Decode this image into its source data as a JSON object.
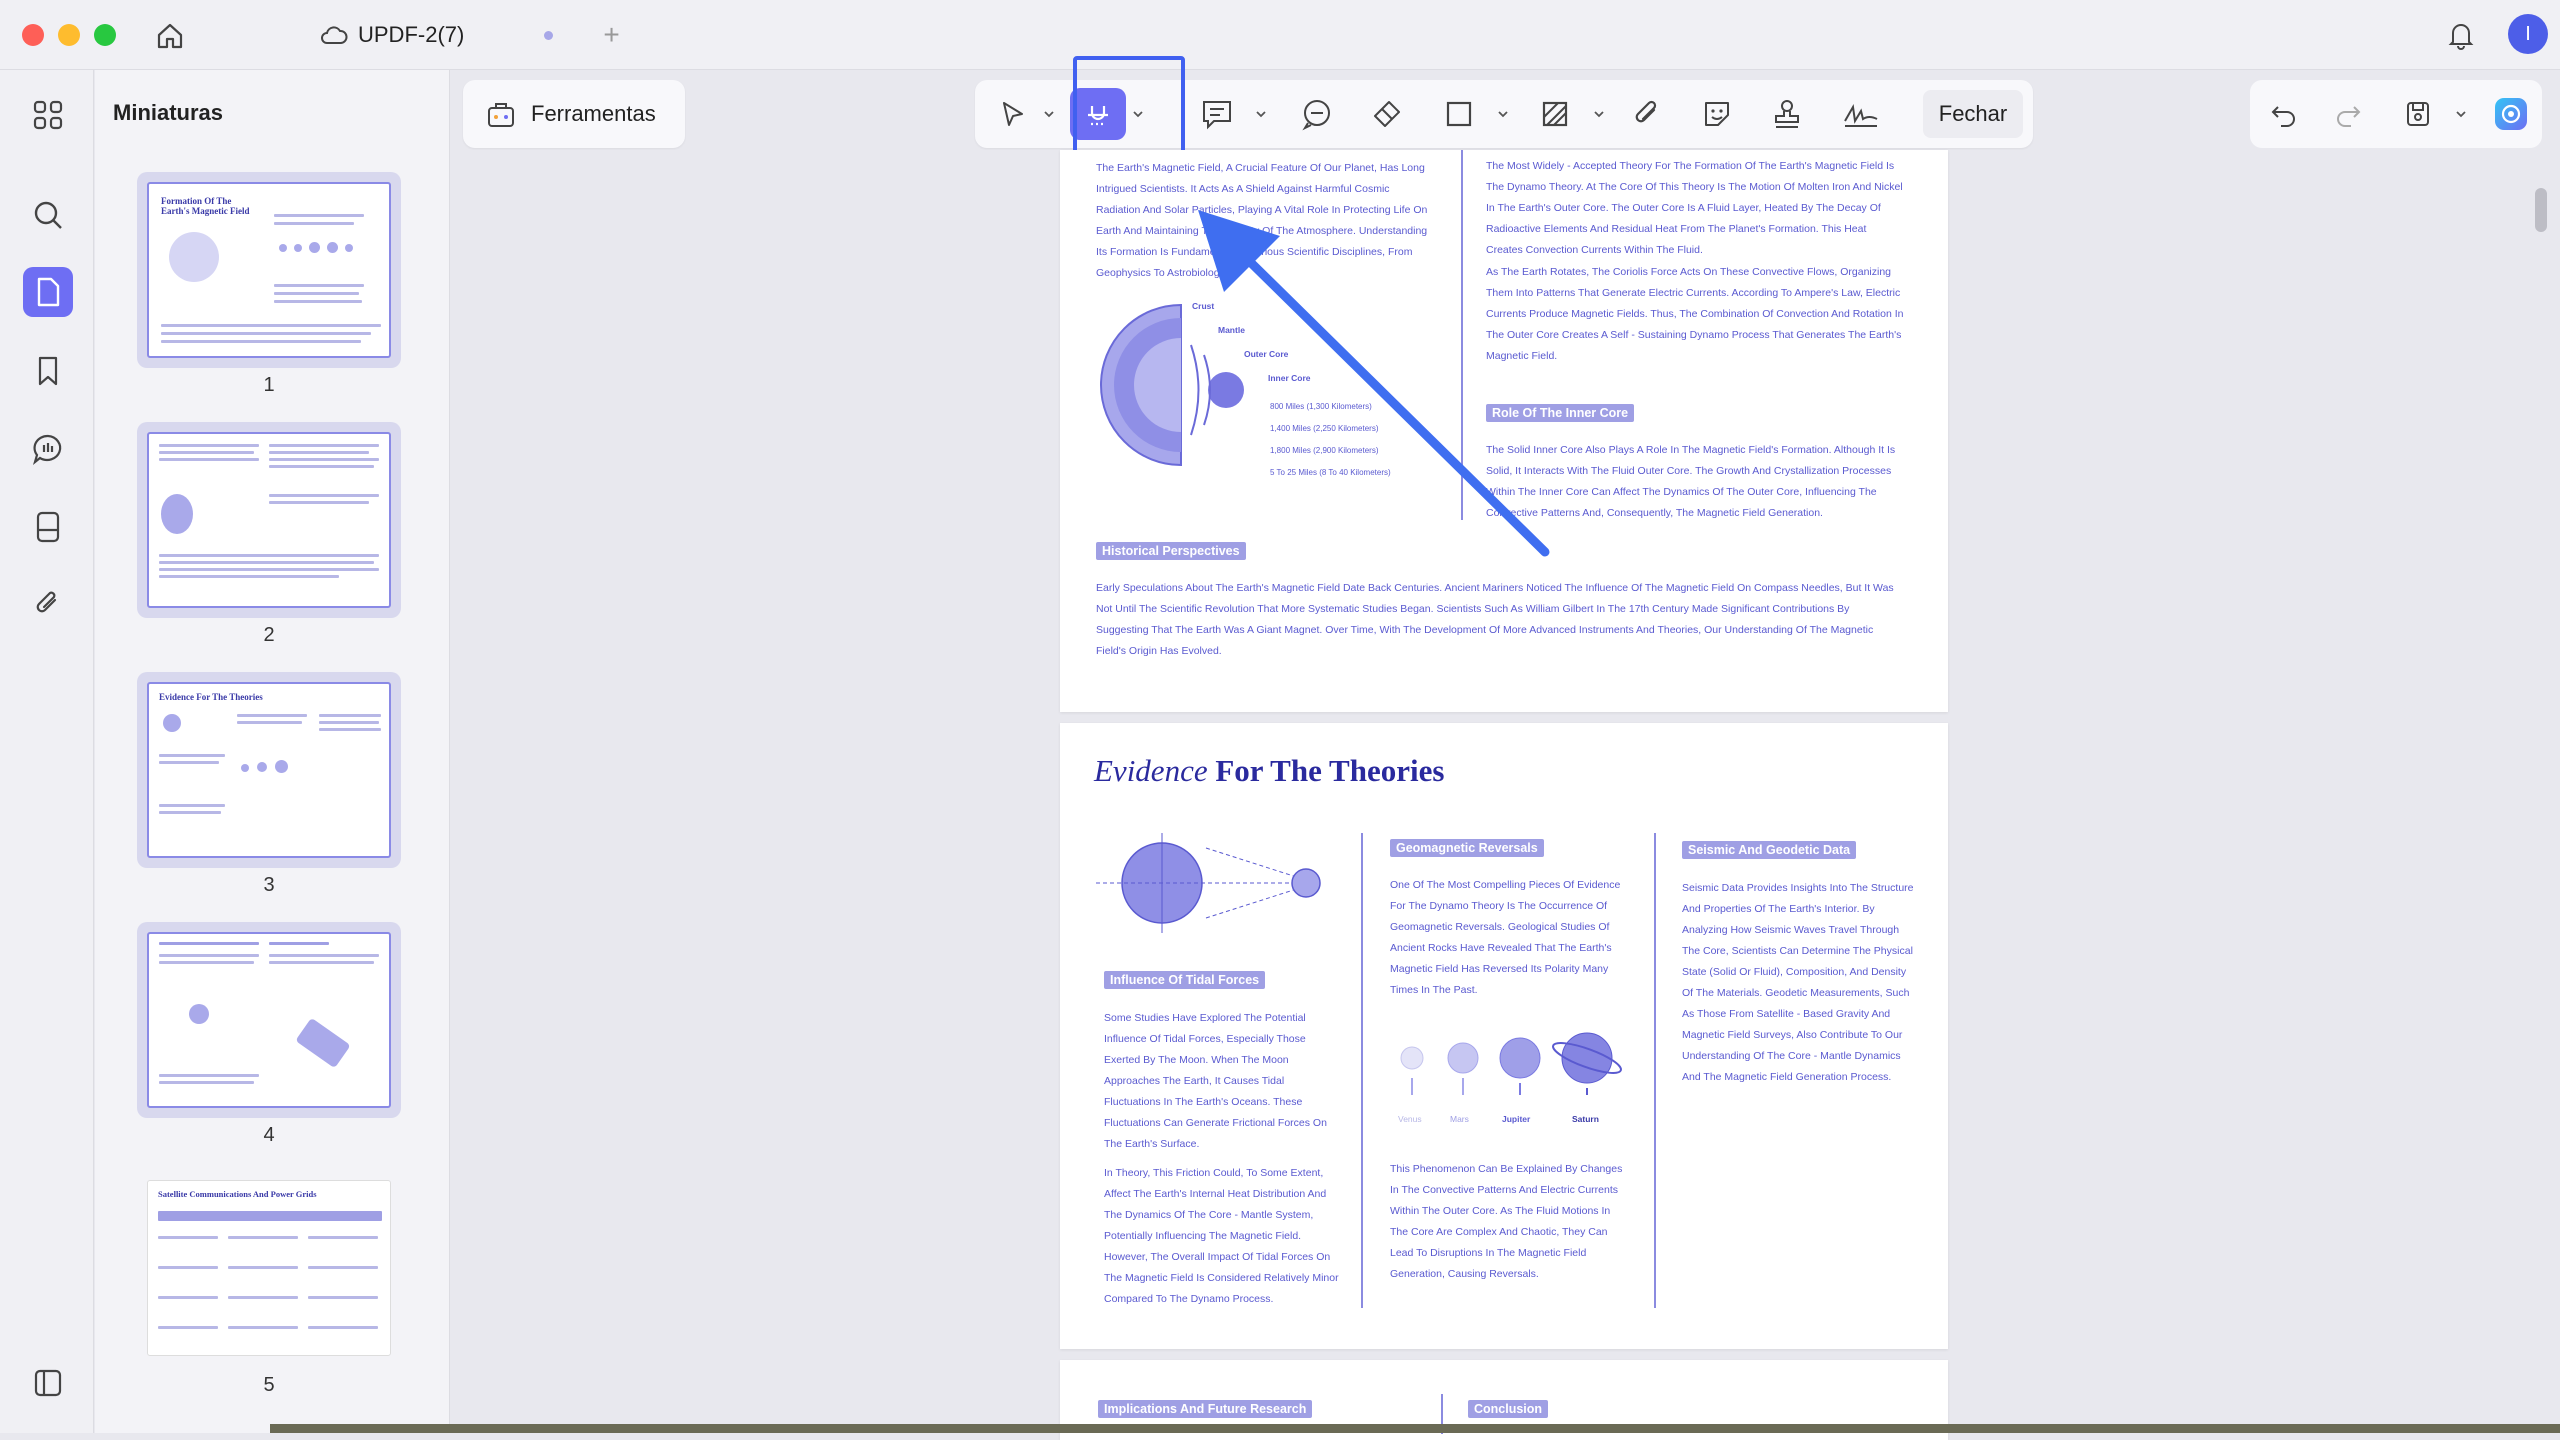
{
  "app": {
    "tab_title": "UPDF-2(7)",
    "tab_add": "+"
  },
  "sidebar": {
    "panel_title": "Miniaturas",
    "thumbnails": [
      {
        "number": "1"
      },
      {
        "number": "2"
      },
      {
        "number": "3"
      },
      {
        "number": "4"
      },
      {
        "number": "5"
      }
    ],
    "thumb_titles": {
      "p1": "Formation Of The Earth's Magnetic Field",
      "p3": "Evidence For The Theories",
      "p5": "Satellite Communications And Power Grids"
    }
  },
  "toolbar": {
    "tools_label": "Ferramentas",
    "close_label": "Fechar"
  },
  "page2": {
    "intro": "The Earth's Magnetic Field, A Crucial Feature Of Our Planet, Has Long Intrigued Scientists. It Acts As A Shield Against Harmful Cosmic Radiation And Solar Particles, Playing A Vital Role In Protecting Life On Earth And Maintaining The Stability Of The Atmosphere. Understanding Its Formation Is Fundamental To Various Scientific Disciplines, From Geophysics To Astrobiology.",
    "dynamo": "The Most Widely - Accepted Theory For The Formation Of The Earth's Magnetic Field Is The Dynamo Theory. At The Core Of This Theory Is The Motion Of Molten Iron And Nickel In The Earth's Outer Core. The Outer Core Is A Fluid Layer, Heated By The Decay Of Radioactive Elements And Residual Heat From The Planet's Formation. This Heat Creates Convection Currents Within The Fluid.",
    "coriolis": "As The Earth Rotates, The Coriolis Force Acts On These Convective Flows, Organizing Them Into Patterns That Generate Electric Currents. According To Ampere's Law, Electric Currents Produce Magnetic Fields. Thus, The Combination Of Convection And Rotation In The Outer Core Creates A Self - Sustaining Dynamo Process That Generates The Earth's Magnetic Field.",
    "inner_core_head": "Role Of The Inner Core",
    "inner_core": "The Solid Inner Core Also Plays A Role In The Magnetic Field's Formation. Although It Is Solid, It Interacts With The Fluid Outer Core. The Growth And Crystallization Processes Within The Inner Core Can Affect The Dynamics Of The Outer Core, Influencing The Convective Patterns And, Consequently, The Magnetic Field Generation.",
    "layers": [
      "Crust",
      "Mantle",
      "Outer Core",
      "Inner Core"
    ],
    "distances": [
      "800 Miles (1,300 Kilometers)",
      "1,400 Miles (2,250 Kilometers)",
      "1,800 Miles (2,900 Kilometers)",
      "5 To 25 Miles (8 To 40 Kilometers)"
    ],
    "historical_head": "Historical Perspectives",
    "historical": "Early Speculations About The Earth's Magnetic Field Date Back Centuries. Ancient Mariners Noticed The Influence Of The Magnetic Field On Compass Needles, But It Was Not Until The Scientific Revolution That More Systematic Studies Began. Scientists Such As William Gilbert In The 17th Century Made Significant Contributions By Suggesting That The Earth Was A Giant Magnet. Over Time, With The Development Of More Advanced Instruments And Theories, Our Understanding Of The Magnetic Field's Origin Has Evolved."
  },
  "page3": {
    "title_italic": "Evidence",
    "title_rest": "For The Theories",
    "geomag_head": "Geomagnetic Reversals",
    "geomag": "One Of The Most Compelling Pieces Of Evidence For The Dynamo Theory Is The Occurrence Of Geomagnetic Reversals. Geological Studies Of Ancient Rocks Have Revealed That The Earth's Magnetic Field Has Reversed Its Polarity Many Times In The Past.",
    "planets": [
      "Venus",
      "Mars",
      "Jupiter",
      "Saturn"
    ],
    "phenomenon": "This Phenomenon Can Be Explained By Changes In The Convective Patterns And Electric Currents Within The Outer Core. As The Fluid Motions In The Core Are Complex And Chaotic, They Can Lead To Disruptions In The Magnetic Field Generation, Causing Reversals.",
    "seismic_head": "Seismic And Geodetic Data",
    "seismic": "Seismic Data Provides Insights Into The Structure And Properties Of The Earth's Interior. By Analyzing How Seismic Waves Travel Through The Core, Scientists Can Determine The Physical State (Solid Or Fluid), Composition, And Density Of The Materials. Geodetic Measurements, Such As Those From Satellite - Based Gravity And Magnetic Field Surveys, Also Contribute To Our Understanding Of The Core - Mantle Dynamics And The Magnetic Field Generation Process.",
    "tidal_head": "Influence Of Tidal Forces",
    "tidal": "Some Studies Have Explored The Potential Influence Of Tidal Forces, Especially Those Exerted By The Moon. When The Moon Approaches The Earth, It Causes Tidal Fluctuations In The Earth's Oceans. These Fluctuations Can Generate Frictional Forces On The Earth's Surface.",
    "friction": "In Theory, This Friction Could, To Some Extent, Affect The Earth's Internal Heat Distribution And The Dynamics Of The Core - Mantle System, Potentially Influencing The Magnetic Field. However, The Overall Impact Of Tidal Forces On The Magnetic Field Is Considered Relatively Minor Compared To The Dynamo Process."
  },
  "page4": {
    "implications_head": "Implications And Future Research",
    "conclusion_head": "Conclusion"
  }
}
